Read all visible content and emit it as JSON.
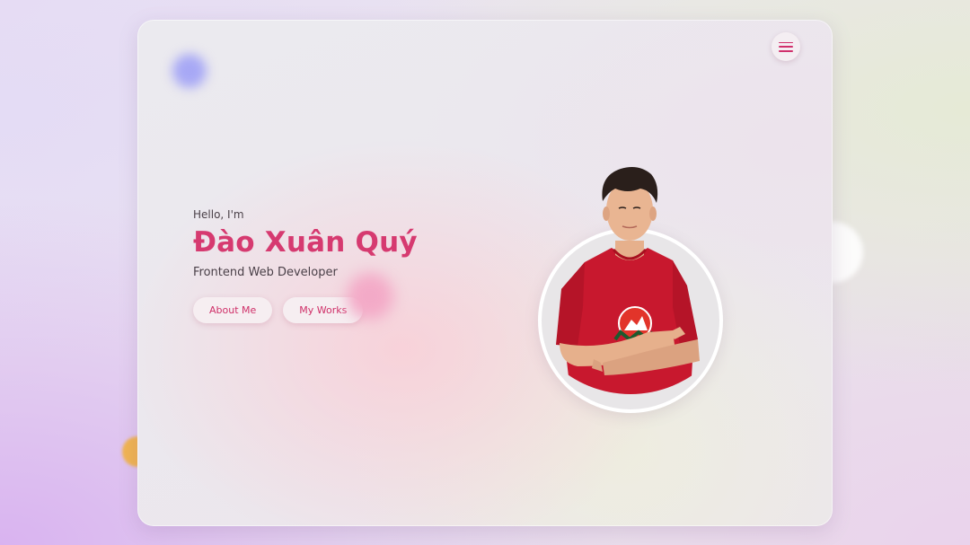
{
  "hero": {
    "greeting": "Hello, I'm",
    "name": "Đào Xuân Quý",
    "role": "Frontend Web Developer"
  },
  "buttons": {
    "about": "About Me",
    "works": "My Works"
  },
  "icons": {
    "menu": "menu-icon"
  },
  "colors": {
    "accent": "#d63a70",
    "shirt": "#c8182e"
  }
}
